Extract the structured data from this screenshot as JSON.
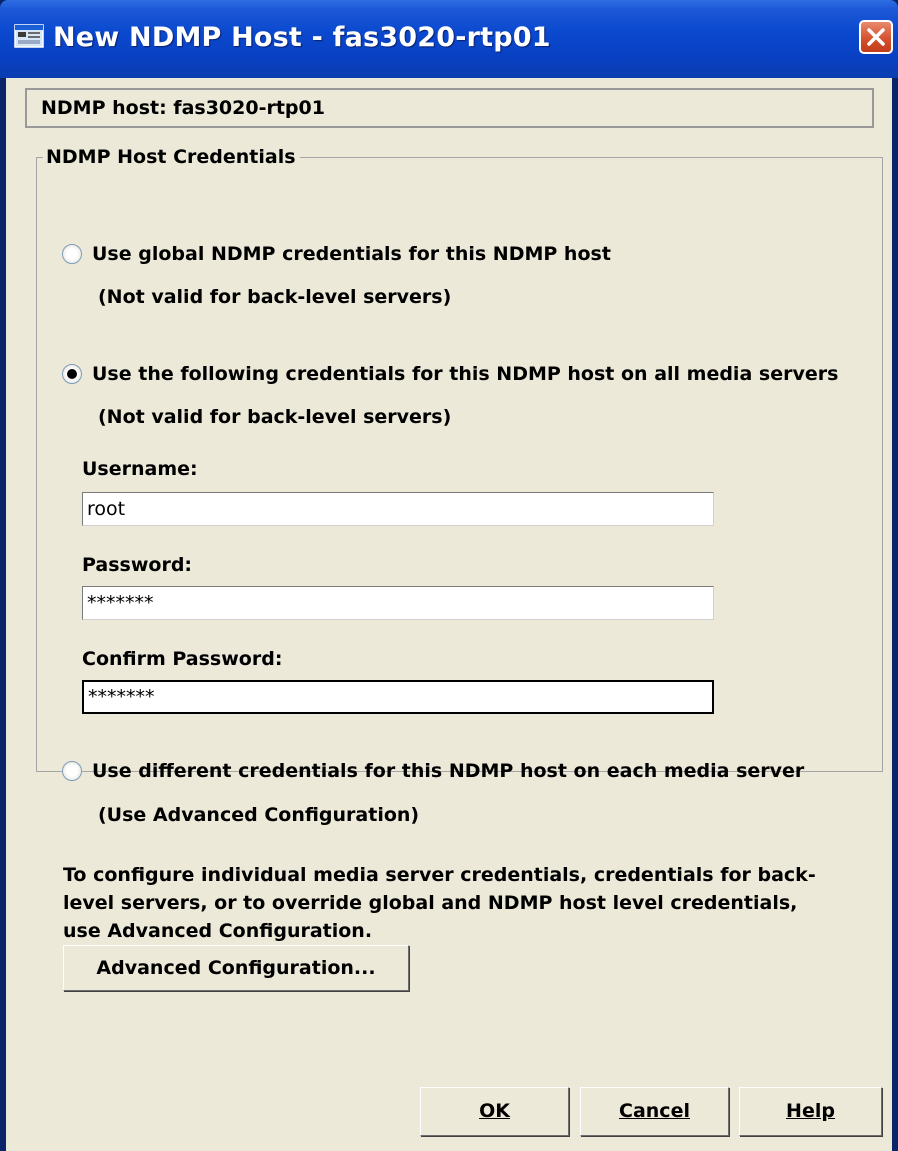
{
  "window": {
    "title": "New NDMP Host - fas3020-rtp01"
  },
  "host_box": {
    "label": "NDMP host: fas3020-rtp01"
  },
  "credentials_group": {
    "title": "NDMP Host Credentials",
    "option_global": {
      "label": "Use global NDMP credentials for this NDMP host",
      "note": "(Not valid for back-level servers)",
      "selected": false
    },
    "option_following": {
      "label": "Use the following credentials for this NDMP host on all media servers",
      "note": "(Not valid for back-level servers)",
      "selected": true
    },
    "username": {
      "label": "Username:",
      "value": "root"
    },
    "password": {
      "label": "Password:",
      "value": "*******"
    },
    "confirm_password": {
      "label": "Confirm Password:",
      "value": "*******"
    },
    "option_different": {
      "label": "Use different credentials for this NDMP host on each media server",
      "note": "(Use Advanced Configuration)",
      "selected": false
    },
    "help_text": "To configure individual media server credentials, credentials for back-level servers, or to override global and NDMP host level credentials, use Advanced Configuration.",
    "advanced_button": "Advanced Configuration..."
  },
  "buttons": {
    "ok": "OK",
    "cancel": "Cancel",
    "help": "Help"
  },
  "colors": {
    "titlebar": "#0b49cf",
    "dialog_bg": "#ece9d8",
    "close_button": "#d34e2b"
  }
}
